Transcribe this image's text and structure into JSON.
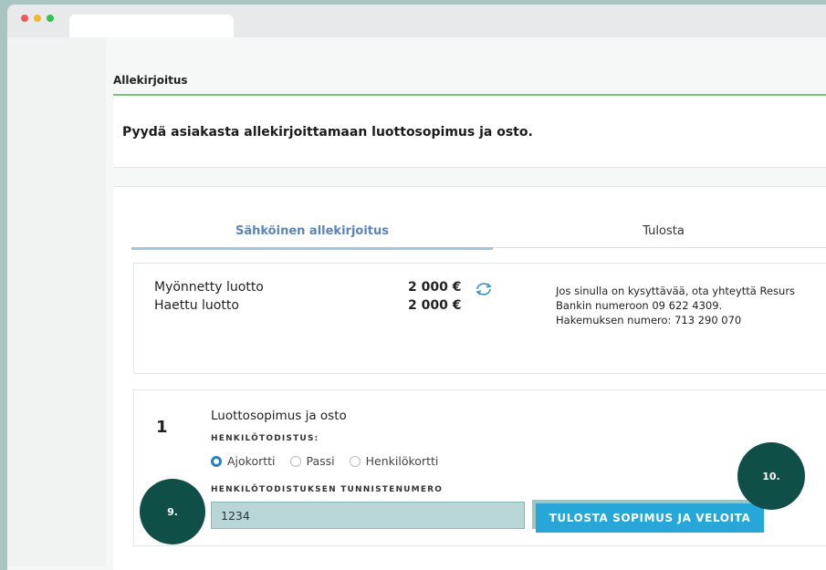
{
  "breadcrumb": "Allekirjoitus",
  "instruction": "Pyydä asiakasta allekirjoittamaan luottosopimus ja osto.",
  "tabs": [
    {
      "label": "Sähköinen allekirjoitus",
      "active": true
    },
    {
      "label": "Tulosta",
      "active": false
    }
  ],
  "credit": {
    "granted_label": "Myönnetty luotto",
    "granted_value": "2 000 €",
    "applied_label": "Haettu luotto",
    "applied_value": "2 000 €"
  },
  "info": {
    "line1": "Jos sinulla on kysyttävää, ota yhteyttä Resurs",
    "line2": "Bankin numeroon 09 622 4309.",
    "line3": "Hakemuksen numero: 713 290 070"
  },
  "step": {
    "number": "1",
    "title": "Luottosopimus ja osto",
    "id_doc_label": "HENKILÖTODISTUS:",
    "options": [
      {
        "label": "Ajokortti",
        "checked": true
      },
      {
        "label": "Passi",
        "checked": false
      },
      {
        "label": "Henkilökortti",
        "checked": false
      }
    ],
    "id_number_label": "HENKILÖTODISTUKSEN TUNNISTENUMERO",
    "id_number_value": "1234",
    "submit_label": "TULOSTA SOPIMUS JA VELOITA"
  },
  "callouts": {
    "c9": "9.",
    "c10": "10."
  },
  "icons": {
    "refresh": "refresh-icon"
  },
  "colors": {
    "accent": "#27a6d8",
    "tab_active": "#5b84b8",
    "callout": "#0f4f47",
    "green_line": "#7cc47a"
  }
}
